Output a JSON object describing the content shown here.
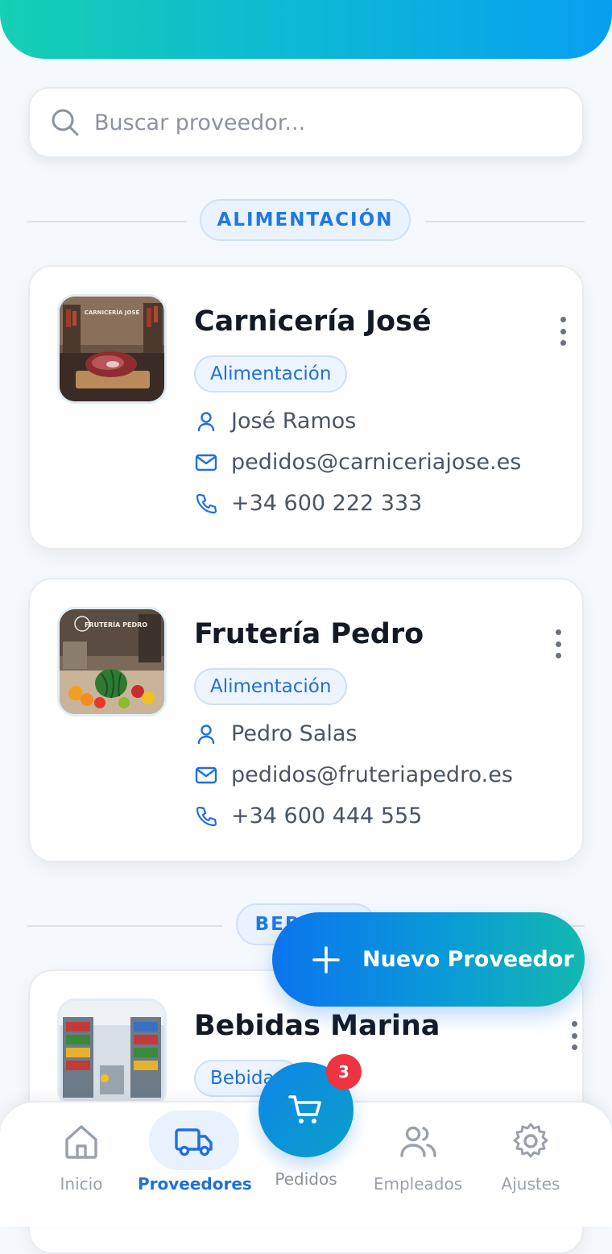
{
  "search": {
    "placeholder": "Buscar proveedor..."
  },
  "sections": [
    {
      "label": "ALIMENTACIÓN"
    },
    {
      "label": "BEBIDAS"
    }
  ],
  "suppliers": [
    {
      "name": "Carnicería José",
      "category": "Alimentación",
      "contact": "José Ramos",
      "email": "pedidos@carniceriajose.es",
      "phone": "+34 600 222 333",
      "image_sign": "CARNICERÍA JOSÉ"
    },
    {
      "name": "Frutería Pedro",
      "category": "Alimentación",
      "contact": "Pedro Salas",
      "email": "pedidos@fruteriapedro.es",
      "phone": "+34 600 444 555",
      "image_sign": "FRUTERÍA PEDRO"
    },
    {
      "name": "Bebidas Marina",
      "category": "Bebidas",
      "contact": "",
      "email": "",
      "phone": ""
    }
  ],
  "fab": {
    "label": "Nuevo Proveedor"
  },
  "cart": {
    "badge_count": "3"
  },
  "nav": {
    "items": [
      {
        "label": "Inicio",
        "icon": "home-icon"
      },
      {
        "label": "Proveedores",
        "icon": "truck-icon",
        "active": true
      },
      {
        "label": "Pedidos",
        "icon": "cart-icon"
      },
      {
        "label": "Empleados",
        "icon": "users-icon"
      },
      {
        "label": "Ajustes",
        "icon": "gear-icon"
      }
    ]
  },
  "colors": {
    "accent": "#1f6fe0",
    "gradient_start": "#14cfb3",
    "gradient_end": "#079ff0",
    "badge_red": "#ef3340"
  }
}
